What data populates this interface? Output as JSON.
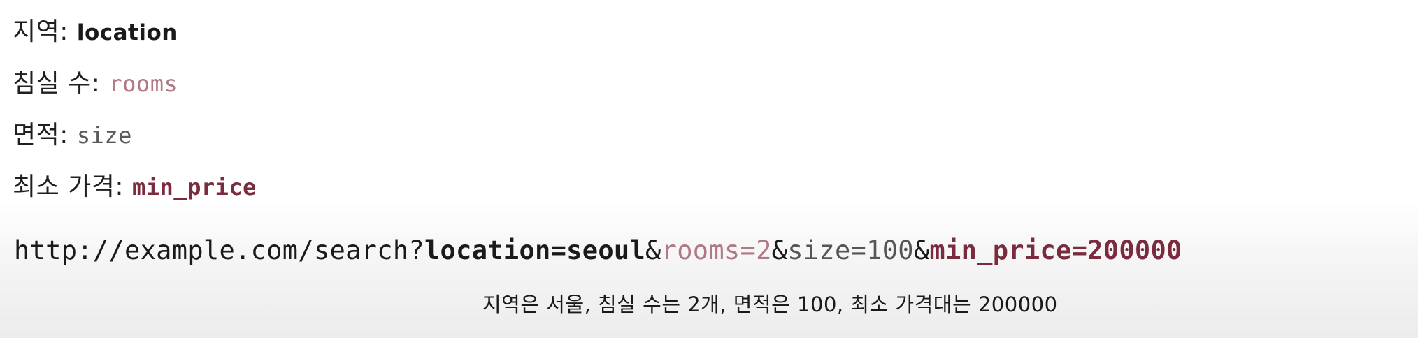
{
  "params": [
    {
      "label": "지역:",
      "name": "location"
    },
    {
      "label": "침실 수:",
      "name": "rooms"
    },
    {
      "label": "면적:",
      "name": "size"
    },
    {
      "label": "최소 가격:",
      "name": "min_price"
    }
  ],
  "url": {
    "base": "http://example.com/search?",
    "location_part": "location=seoul",
    "amp1": "&",
    "rooms_part": "rooms=2",
    "amp2": "&",
    "size_part": "size=100",
    "amp3": "&",
    "min_price_part": "min_price=200000"
  },
  "caption": "지역은 서울, 침실 수는 2개, 면적은 100, 최소 가격대는 200000",
  "colors": {
    "location": "#1a1a1a",
    "rooms": "#b07a84",
    "size": "#5a5a5a",
    "min_price": "#7a2b3d"
  }
}
